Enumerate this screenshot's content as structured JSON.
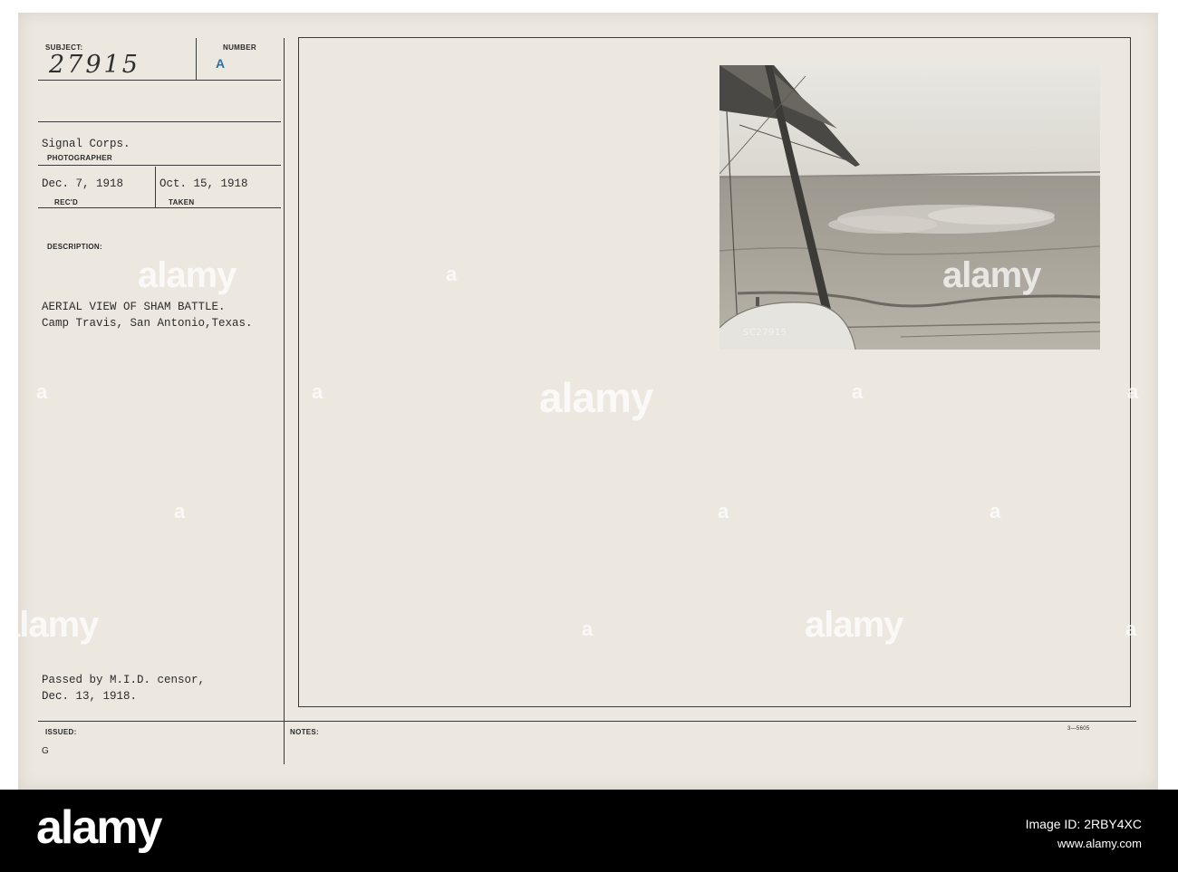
{
  "card": {
    "subject_label": "SUBJECT:",
    "subject_value": "27915",
    "number_label": "NUMBER",
    "number_value": "A",
    "photographer_value": "Signal Corps.",
    "photographer_label": "PHOTOGRAPHER",
    "recd_value": "Dec. 7, 1918",
    "recd_label": "REC'D",
    "taken_value": "Oct. 15, 1918",
    "taken_label": "TAKEN",
    "description_label": "DESCRIPTION:",
    "description_line1": "AERIAL VIEW OF SHAM BATTLE.",
    "description_line2": "Camp Travis, San Antonio,Texas.",
    "censor_line1": "Passed by M.I.D. censor,",
    "censor_line2": "Dec. 13, 1918.",
    "issued_label": "ISSUED:",
    "issued_value": "G",
    "notes_label": "NOTES:",
    "form_code": "3—5605",
    "photo_number": "SC27915"
  },
  "watermark": {
    "text": "alamy"
  },
  "footer": {
    "logo": "alamy",
    "image_id": "Image ID: 2RBY4XC",
    "url": "www.alamy.com"
  }
}
